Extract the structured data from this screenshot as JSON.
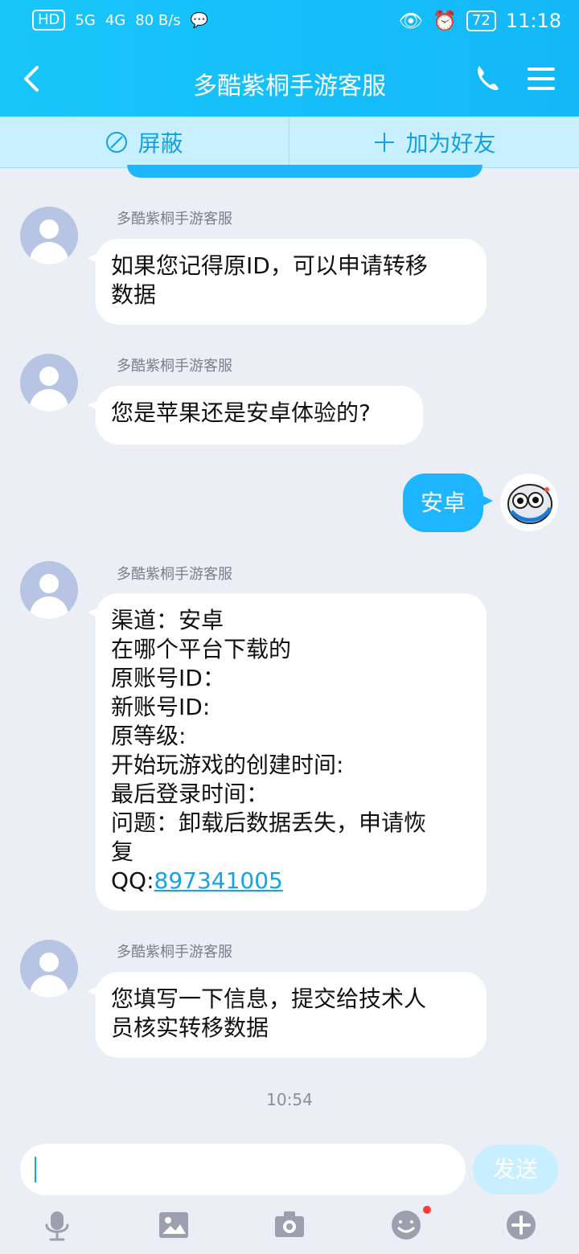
{
  "status": {
    "network": "80 B/s",
    "sim": "HD",
    "net1": "5G",
    "net2": "4G",
    "battery": "72",
    "time": "11:18"
  },
  "chat": {
    "title": "多酷紫桐手游客服",
    "actions": [
      "屏蔽",
      "加为好友"
    ],
    "messages": [
      {
        "sender": "多酷紫桐手游客服",
        "text": "如果您记得原ID，可以申请转移\n数据"
      },
      {
        "sender": "多酷紫桐手游客服",
        "text": "您是苹果还是安卓体验的?"
      },
      {
        "mine": "安卓"
      },
      {
        "sender": "多酷紫桐手游客服",
        "lines": [
          "渠道：安卓",
          "在哪个平台下载的",
          "原账号ID：",
          "新账号ID:",
          "原等级:",
          "开始玩游戏的创建时间:",
          "最后登录时间：",
          "问题：卸载后数据丢失，申请恢",
          "复"
        ],
        "qq_label": "QQ:",
        "qq_number": "897341005"
      },
      {
        "sender": "多酷紫桐手游客服",
        "text": "您填写一下信息，提交给技术人\n员核实转移数据"
      }
    ],
    "timestamp": "10:54"
  },
  "composer": {
    "send": "发送"
  },
  "icons": {
    "back": "back-icon",
    "phone": "phone-icon",
    "menu": "menu-icon",
    "block": "block-icon",
    "add": "add-icon",
    "voice": "microphone-icon",
    "image": "image-icon",
    "camera": "camera-icon",
    "emoji": "emoji-icon",
    "more": "plus-icon"
  },
  "colors": {
    "brand": "#13b8f7",
    "light": "#c9f0ff",
    "bg": "#eceef5"
  }
}
